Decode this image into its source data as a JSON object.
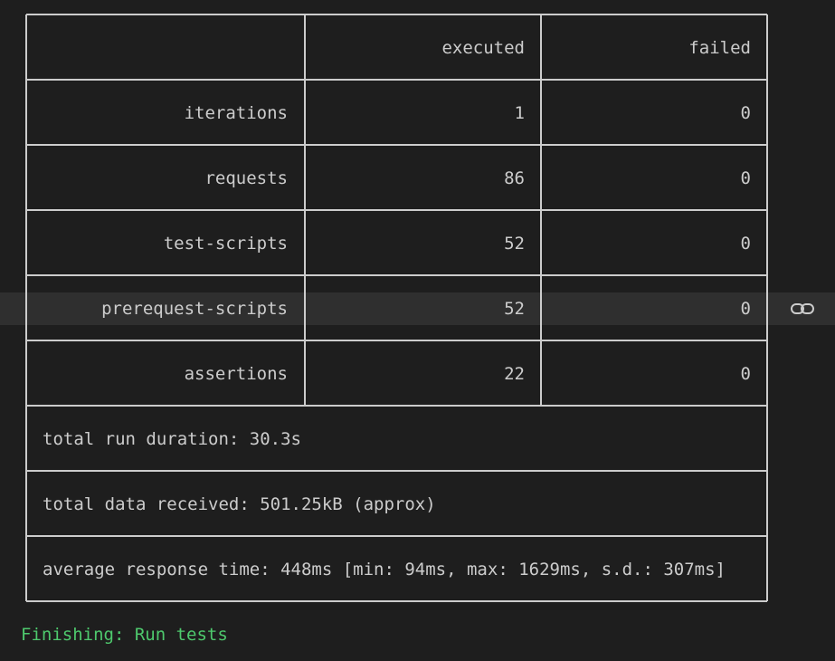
{
  "table": {
    "header": [
      "",
      "executed",
      "failed"
    ],
    "rows": [
      {
        "label": "iterations",
        "executed": "1",
        "failed": "0"
      },
      {
        "label": "requests",
        "executed": "86",
        "failed": "0"
      },
      {
        "label": "test-scripts",
        "executed": "52",
        "failed": "0"
      },
      {
        "label": "prerequest-scripts",
        "executed": "52",
        "failed": "0"
      },
      {
        "label": "assertions",
        "executed": "22",
        "failed": "0"
      }
    ],
    "summary": [
      "total run duration: 30.3s",
      "total data received: 501.25kB (approx)",
      "average response time: 448ms [min: 94ms, max: 1629ms, s.d.: 307ms]"
    ]
  },
  "status": {
    "finishing": "Finishing: Run tests"
  },
  "icons": {
    "row_action": "link-icon"
  },
  "colors": {
    "background": "#1e1e1e",
    "text": "#cccccc",
    "border": "#cccccc",
    "highlight_row": "#2f2f2f",
    "success": "#4ec96d"
  }
}
